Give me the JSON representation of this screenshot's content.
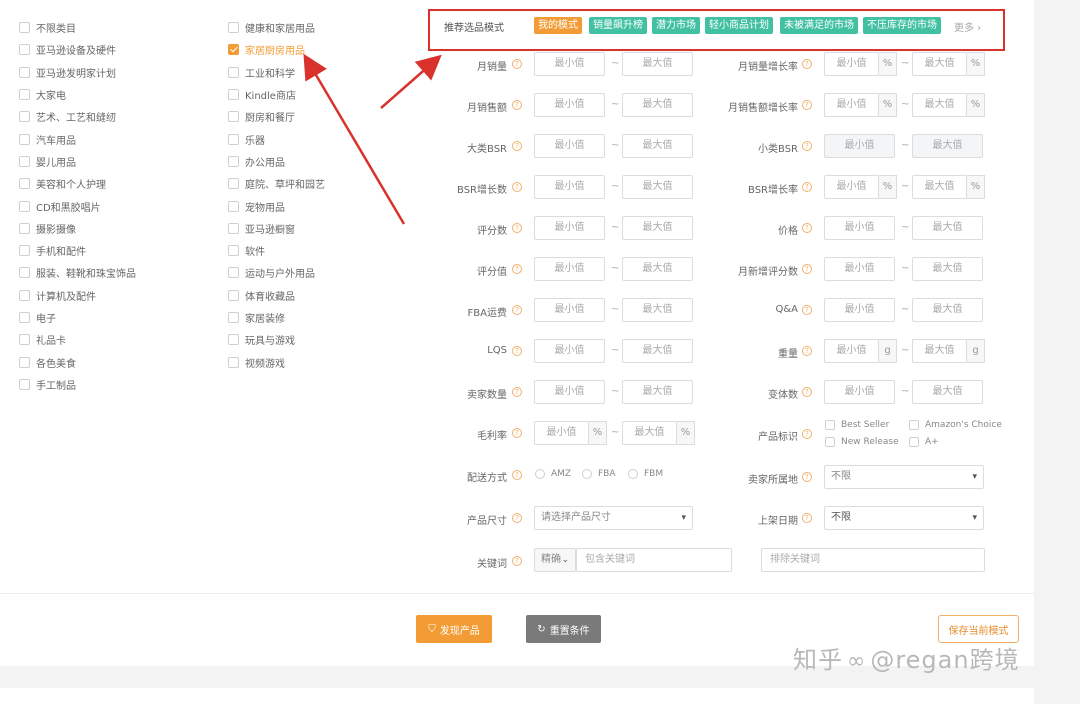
{
  "categories": {
    "col1": [
      "不限类目",
      "亚马逊设备及硬件",
      "亚马逊发明家计划",
      "大家电",
      "艺术、工艺和缝纫",
      "汽车用品",
      "婴儿用品",
      "美容和个人护理",
      "CD和黑胶唱片",
      "摄影摄像",
      "手机和配件",
      "服装、鞋靴和珠宝饰品",
      "计算机及配件",
      "电子",
      "礼品卡",
      "各色美食",
      "手工制品"
    ],
    "col2": [
      "健康和家居用品",
      "家居厨房用品",
      "工业和科学",
      "Kindle商店",
      "厨房和餐厅",
      "乐器",
      "办公用品",
      "庭院、草坪和园艺",
      "宠物用品",
      "亚马逊橱窗",
      "软件",
      "运动与户外用品",
      "体育收藏品",
      "家居装修",
      "玩具与游戏",
      "视频游戏"
    ],
    "checked": "家居厨房用品"
  },
  "mode": {
    "label": "推荐选品模式",
    "pills": [
      "我的模式",
      "销量飙升榜",
      "潜力市场",
      "轻小商品计划",
      "未被满足的市场",
      "不压库存的市场"
    ],
    "more": "更多",
    "colors": {
      "active": "#f39c36",
      "pill": "#42c0a2",
      "highlight_box": "#d9322d"
    }
  },
  "placeholders": {
    "min": "最小值",
    "max": "最大值",
    "tilde": "~",
    "percent": "%",
    "gram": "g"
  },
  "filters": {
    "left": [
      "月销量",
      "月销售额",
      "大类BSR",
      "BSR增长数",
      "评分数",
      "评分值",
      "FBA运费",
      "LQS",
      "卖家数量",
      "毛利率"
    ],
    "right": [
      "月销量增长率",
      "月销售额增长率",
      "小类BSR",
      "BSR增长率",
      "价格",
      "月新增评分数",
      "Q&A",
      "重量",
      "变体数"
    ]
  },
  "product_tags": {
    "label": "产品标识",
    "options": [
      "Best Seller",
      "Amazon's Choice",
      "New Release",
      "A+"
    ]
  },
  "shipping": {
    "label": "配送方式",
    "options": [
      "AMZ",
      "FBA",
      "FBM"
    ]
  },
  "seller_location": {
    "label": "卖家所属地",
    "value": "不限"
  },
  "size": {
    "label": "产品尺寸",
    "value": "请选择产品尺寸"
  },
  "launch_date": {
    "label": "上架日期",
    "value": "不限"
  },
  "keyword": {
    "label": "关键词",
    "match": "精确",
    "include_placeholder": "包含关键词",
    "exclude_placeholder": "排除关键词"
  },
  "buttons": {
    "find": "发现产品",
    "reset": "重置条件",
    "save": "保存当前模式"
  },
  "watermark": {
    "site": "知乎",
    "author": "@regan跨境"
  }
}
